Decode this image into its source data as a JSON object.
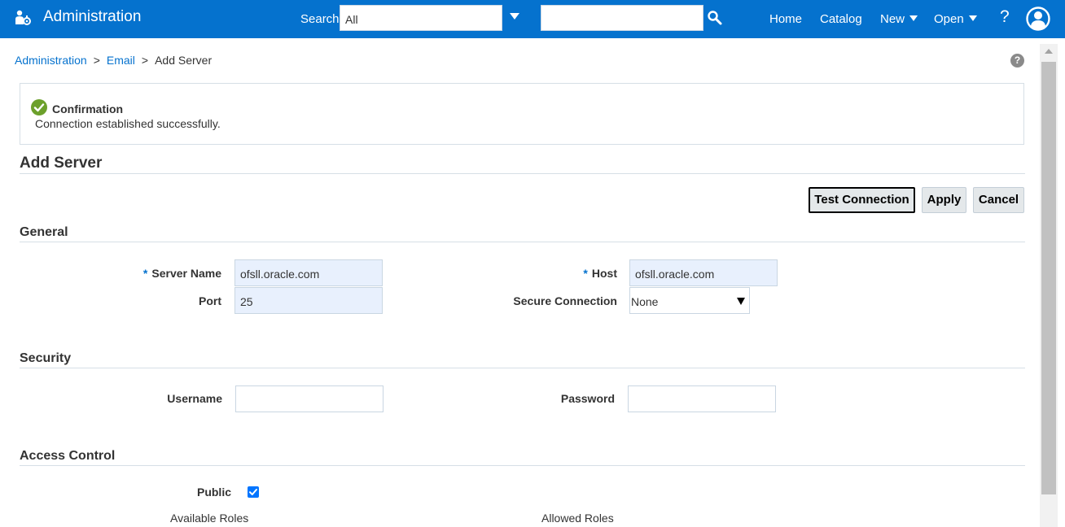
{
  "header": {
    "app_title": "Administration",
    "search_label": "Search",
    "search_scope": "All",
    "search_placeholder": "",
    "nav": {
      "home": "Home",
      "catalog": "Catalog",
      "new": "New",
      "open": "Open",
      "help": "?"
    },
    "accent_color": "#0572ce"
  },
  "breadcrumb": {
    "items": [
      "Administration",
      "Email",
      "Add Server"
    ],
    "separator": ">"
  },
  "help_glyph": "?",
  "confirmation": {
    "title": "Confirmation",
    "message": "Connection established successfully.",
    "status_color": "#6ca02b"
  },
  "page": {
    "title": "Add Server",
    "buttons": {
      "test_connection": "Test Connection",
      "apply": "Apply",
      "cancel": "Cancel"
    }
  },
  "general": {
    "heading": "General",
    "required_marker": "*",
    "server_name_label": "Server Name",
    "server_name_value": "ofsll.oracle.com",
    "host_label": "Host",
    "host_value": "ofsll.oracle.com",
    "port_label": "Port",
    "port_value": "25",
    "secure_connection_label": "Secure Connection",
    "secure_connection_value": "None"
  },
  "security": {
    "heading": "Security",
    "username_label": "Username",
    "username_value": "",
    "password_label": "Password",
    "password_value": ""
  },
  "access_control": {
    "heading": "Access Control",
    "public_label": "Public",
    "public_checked": true,
    "available_roles_label": "Available Roles",
    "allowed_roles_label": "Allowed Roles"
  }
}
